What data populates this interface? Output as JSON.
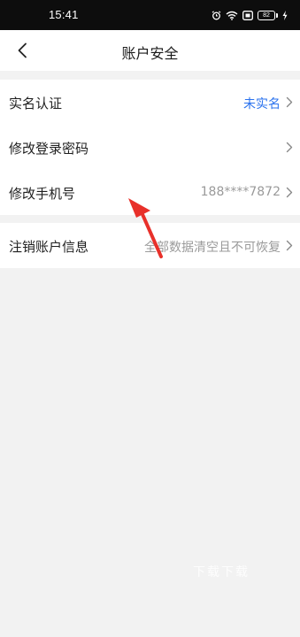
{
  "status_bar": {
    "time": "15:41",
    "battery": "82",
    "icons": [
      "alarm-icon",
      "wifi-icon",
      "sim-icon",
      "battery-icon",
      "charging-icon"
    ]
  },
  "nav": {
    "back_icon": "chevron-left-icon",
    "title": "账户安全"
  },
  "settings": {
    "rows": [
      {
        "label": "实名认证",
        "value": "未实名",
        "value_color": "#2a72ee"
      },
      {
        "label": "修改登录密码",
        "value": ""
      },
      {
        "label": "修改手机号",
        "value": "188****7872"
      }
    ],
    "delete_row": {
      "label": "注销账户信息",
      "value": "全部数据清空且不可恢复"
    }
  },
  "annotation": {
    "arrow_color": "#e8302a"
  },
  "watermark": "下载下载"
}
